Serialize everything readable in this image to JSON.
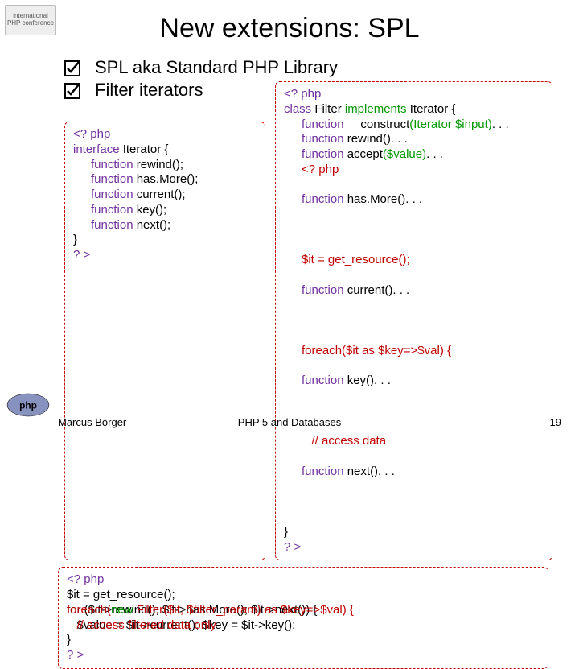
{
  "title": "New extensions: SPL",
  "bullets": [
    "SPL aka Standard PHP Library",
    "Filter iterators"
  ],
  "code_left": {
    "l1": "<? php",
    "l2": "interface Iterator {",
    "l3": "function rewind();",
    "l4": "function has.More();",
    "l5": "function current();",
    "l6": "function key();",
    "l7": "function next();",
    "l8": "}",
    "l9": "? >"
  },
  "code_right": {
    "l1": "<? php",
    "l2a": "class Filter ",
    "l2b": "implements",
    "l2c": " Iterator {",
    "l3a": "function __construct",
    "l3b": "(Iterator $input)",
    "l3c": ". . .",
    "l4": "function rewind(). . .",
    "l5a": "function accept",
    "l5b": "($value)",
    "l5c": ". . .",
    "ov1a": "<? php",
    "ov1b": "function has.More(). . .",
    "ov2a": "$it = get_resource();",
    "ov2b": "function current(). . .",
    "ov3a": "foreach($it as $key=>$val) {",
    "ov3b": "function key(). . .",
    "ov4a": "   // access data",
    "ov4b": "function next(). . .",
    "l10": "}",
    "l11": "? >"
  },
  "code_bottom": {
    "l1": "<? php",
    "l2": "$it = get_resource();",
    "ov3a": "for ($it->rewind(); $it->has.More(); $it->next()) {",
    "ov3b": "foreach(new Filter($it, $filter_param) as $key=>$val) {",
    "ov4a": "   $value = $it->current(); $key = $it->key();",
    "ov4b": "   // access filtered data only",
    "l5": "}",
    "l6": "? >"
  },
  "footer": {
    "left": "Marcus Börger",
    "center": "PHP 5 and Databases",
    "right": "19"
  },
  "logos": {
    "top": "international PHP conference",
    "bottom": "php"
  }
}
